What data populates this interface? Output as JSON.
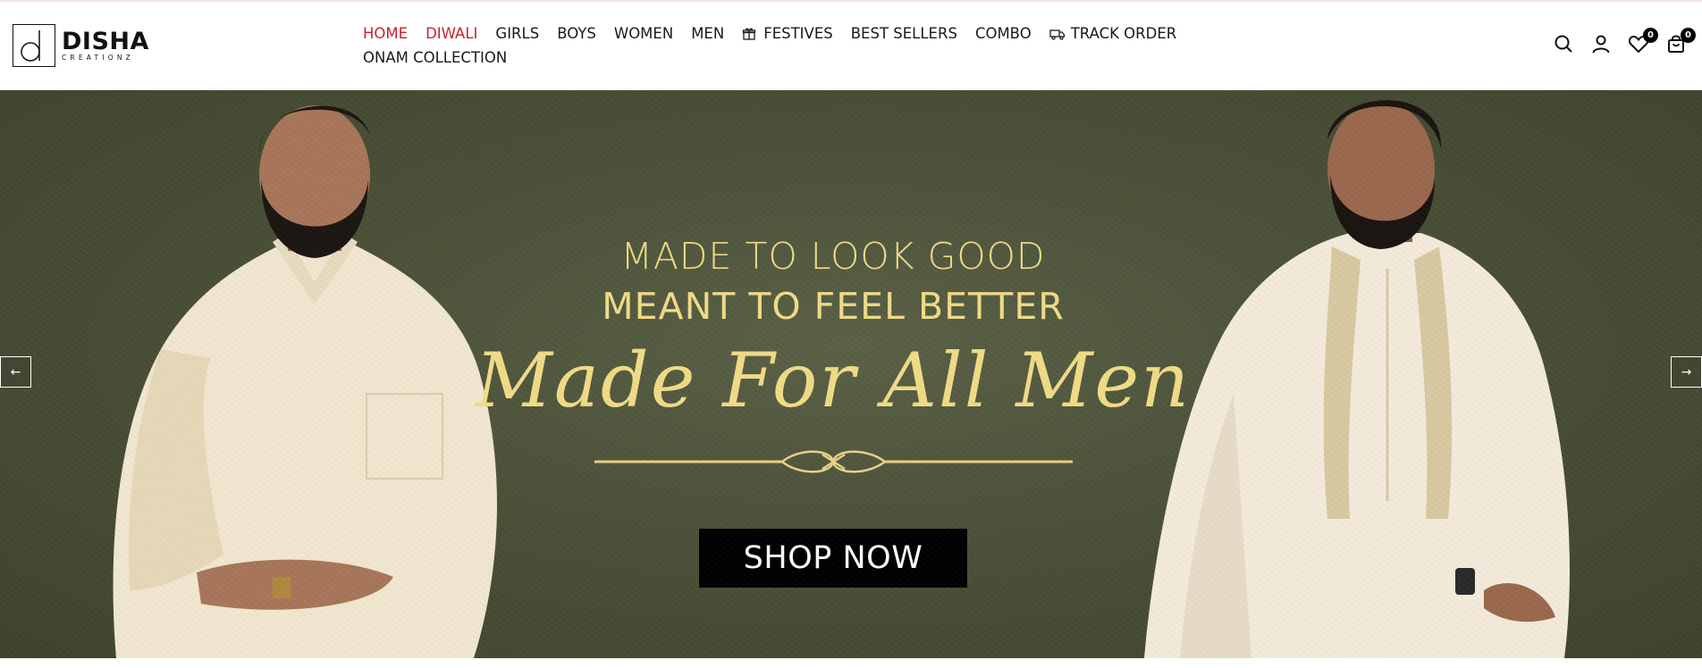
{
  "brand": {
    "name": "DISHA",
    "sub": "CREATIONZ"
  },
  "nav": {
    "items": [
      {
        "label": "HOME",
        "color": "#c8232c"
      },
      {
        "label": "DIWALI",
        "color": "#c8232c"
      },
      {
        "label": "GIRLS"
      },
      {
        "label": "BOYS"
      },
      {
        "label": "WOMEN"
      },
      {
        "label": "MEN"
      },
      {
        "label": "FESTIVES",
        "icon": "gift-icon"
      },
      {
        "label": "BEST SELLERS"
      },
      {
        "label": "COMBO"
      },
      {
        "label": "TRACK ORDER",
        "icon": "truck-icon"
      },
      {
        "label": "ONAM COLLECTION"
      }
    ]
  },
  "actions": {
    "search_icon": "search-icon",
    "account_icon": "user-icon",
    "wishlist_icon": "heart-icon",
    "wishlist_count": "0",
    "cart_icon": "shopping-bag-icon",
    "cart_count": "0"
  },
  "hero": {
    "line1": "MADE TO LOOK GOOD",
    "line2": "MEANT TO FEEL BETTER",
    "script": "Made For All Men",
    "cta": "SHOP NOW",
    "prev_arrow": "←",
    "next_arrow": "→",
    "text_color": "#f1dc87",
    "background_color": "#4b5138"
  }
}
